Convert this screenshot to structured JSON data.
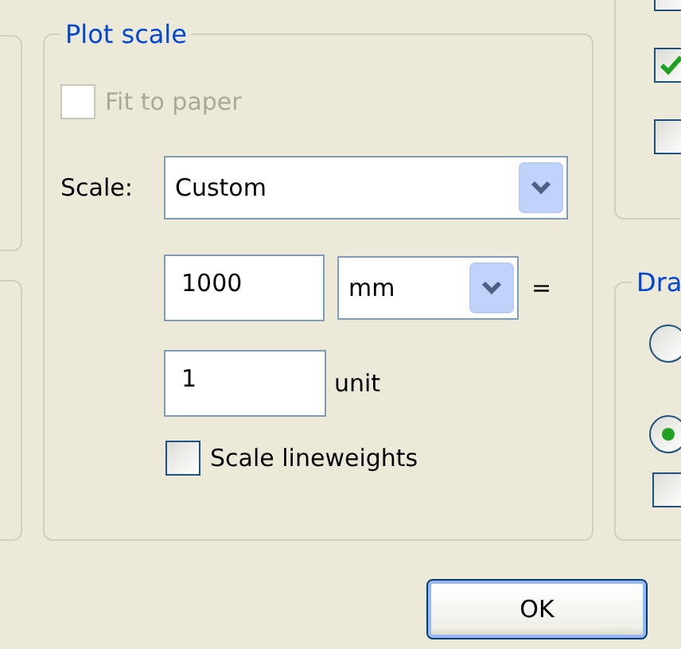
{
  "plot_scale": {
    "title": "Plot scale",
    "fit_to_paper": {
      "label": "Fit to paper",
      "checked": false,
      "disabled": true
    },
    "scale": {
      "label": "Scale:",
      "value": "Custom"
    },
    "paper_amount": {
      "value": "1000"
    },
    "paper_units": {
      "value": "mm"
    },
    "equals": "=",
    "drawing_amount": {
      "value": "1",
      "label": "unit"
    },
    "scale_lineweights": {
      "label": "Scale lineweights",
      "checked": false,
      "disabled": false
    }
  },
  "right_top_checkboxes": [
    {
      "checked": false
    },
    {
      "checked": true
    },
    {
      "checked": false
    }
  ],
  "drawing_group": {
    "title": "Dra",
    "options": [
      {
        "kind": "radio",
        "selected": false
      },
      {
        "kind": "radio",
        "selected": true
      },
      {
        "kind": "checkbox",
        "checked": false
      }
    ]
  },
  "buttons": [
    {
      "label": "OK"
    }
  ]
}
